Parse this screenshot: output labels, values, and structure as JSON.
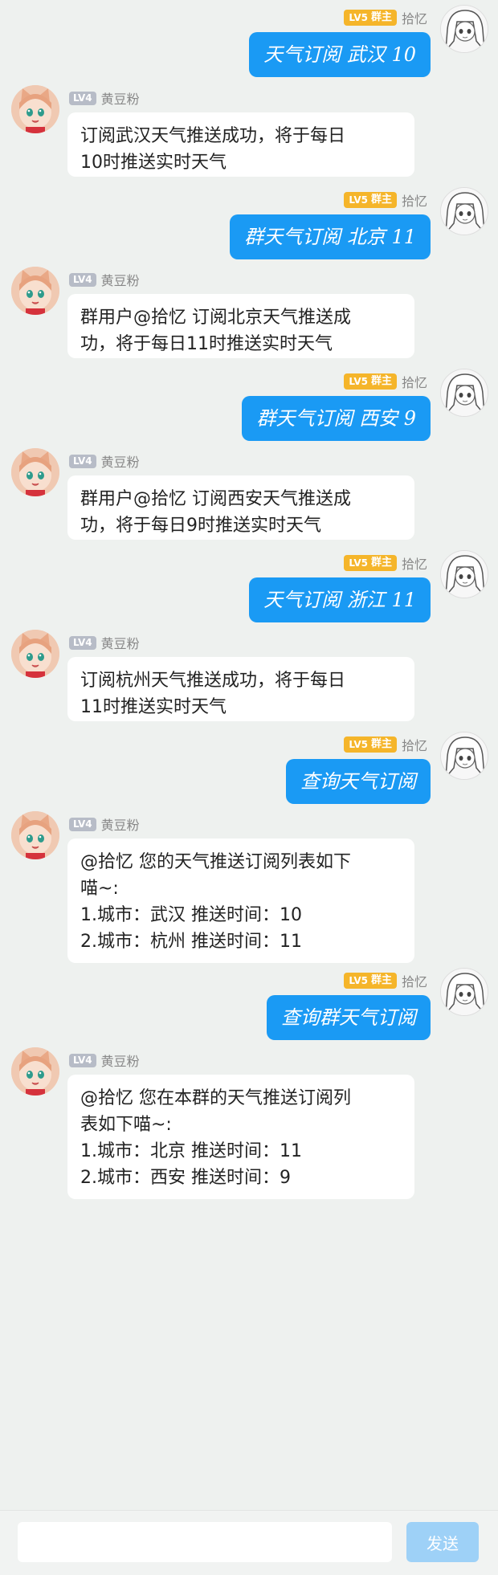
{
  "users": {
    "me": {
      "name": "拾忆",
      "level": "LV5",
      "role": "群主"
    },
    "bot": {
      "name": "黄豆粉",
      "level": "LV4"
    }
  },
  "messages": [
    {
      "side": "right",
      "text": "天气订阅 武汉 10"
    },
    {
      "side": "left",
      "lines": [
        "订阅武汉天气推送成功，将于每日",
        "10时推送实时天气"
      ]
    },
    {
      "side": "right",
      "text": "群天气订阅 北京 11"
    },
    {
      "side": "left",
      "lines": [
        "群用户@拾忆 订阅北京天气推送成",
        "功，将于每日11时推送实时天气"
      ]
    },
    {
      "side": "right",
      "text": "群天气订阅 西安 9"
    },
    {
      "side": "left",
      "lines": [
        "群用户@拾忆 订阅西安天气推送成",
        "功，将于每日9时推送实时天气"
      ]
    },
    {
      "side": "right",
      "text": "天气订阅 浙江 11"
    },
    {
      "side": "left",
      "lines": [
        "订阅杭州天气推送成功，将于每日",
        "11时推送实时天气"
      ]
    },
    {
      "side": "right",
      "text": "查询天气订阅"
    },
    {
      "side": "left",
      "lines": [
        "@拾忆 您的天气推送订阅列表如下",
        "喵~:",
        "1.城市：武汉  推送时间：10",
        "2.城市：杭州  推送时间：11"
      ]
    },
    {
      "side": "right",
      "text": "查询群天气订阅"
    },
    {
      "side": "left",
      "lines": [
        "@拾忆 您在本群的天气推送订阅列",
        "表如下喵~:",
        "1.城市：北京  推送时间：11",
        "2.城市：西安  推送时间：9"
      ]
    }
  ],
  "input": {
    "placeholder": "",
    "send_label": "发送"
  },
  "colors": {
    "bubble_blue": "#1a9af4",
    "owner_badge": "#f5b52a",
    "user_badge": "#b7bcc7",
    "send_disabled": "#9ed1f7"
  }
}
